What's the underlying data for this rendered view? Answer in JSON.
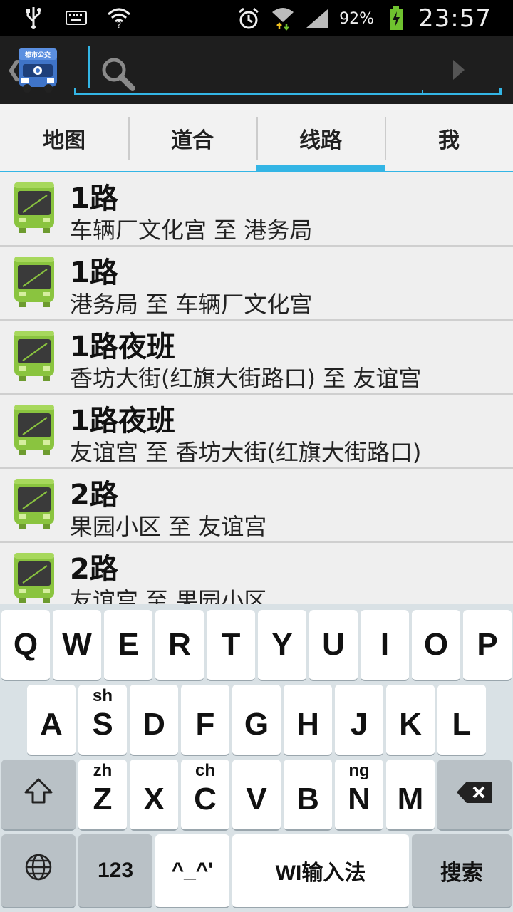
{
  "statusbar": {
    "icons_left": [
      "usb-icon",
      "keyboard-icon",
      "wifi-question-icon"
    ],
    "icons_right": [
      "alarm-icon",
      "wifi-icon",
      "signal-icon"
    ],
    "battery": "92%",
    "time": "23:57"
  },
  "actionbar": {
    "logo_text": "都市公交",
    "search_placeholder": ""
  },
  "tabs": [
    {
      "label": "地图"
    },
    {
      "label": "道合"
    },
    {
      "label": "线路"
    },
    {
      "label": "我"
    }
  ],
  "active_tab": "线路",
  "routes": [
    {
      "name": "1路",
      "route": "车辆厂文化宫 至 港务局"
    },
    {
      "name": "1路",
      "route": "港务局 至 车辆厂文化宫"
    },
    {
      "name": "1路夜班",
      "route": "香坊大街(红旗大街路口) 至 友谊宫"
    },
    {
      "name": "1路夜班",
      "route": "友谊宫 至 香坊大街(红旗大街路口)"
    },
    {
      "name": "2路",
      "route": "果园小区 至 友谊宫"
    },
    {
      "name": "2路",
      "route": "友谊宫 至 果园小区"
    }
  ],
  "keyboard": {
    "row1": [
      "Q",
      "W",
      "E",
      "R",
      "T",
      "Y",
      "U",
      "I",
      "O",
      "P"
    ],
    "row2": [
      {
        "k": "A",
        "s": ""
      },
      {
        "k": "S",
        "s": "sh"
      },
      {
        "k": "D",
        "s": ""
      },
      {
        "k": "F",
        "s": ""
      },
      {
        "k": "G",
        "s": ""
      },
      {
        "k": "H",
        "s": ""
      },
      {
        "k": "J",
        "s": ""
      },
      {
        "k": "K",
        "s": ""
      },
      {
        "k": "L",
        "s": ""
      }
    ],
    "row3": [
      {
        "k": "Z",
        "s": "zh"
      },
      {
        "k": "X",
        "s": ""
      },
      {
        "k": "C",
        "s": "ch"
      },
      {
        "k": "V",
        "s": ""
      },
      {
        "k": "B",
        "s": ""
      },
      {
        "k": "N",
        "s": "ng"
      },
      {
        "k": "M",
        "s": ""
      }
    ],
    "num_label": "123",
    "emoticon_label": "^_^'",
    "space_label": "WI输入法",
    "search_label": "搜索"
  },
  "colors": {
    "accent": "#33b5e5",
    "bus_green": "#8ac43f"
  }
}
